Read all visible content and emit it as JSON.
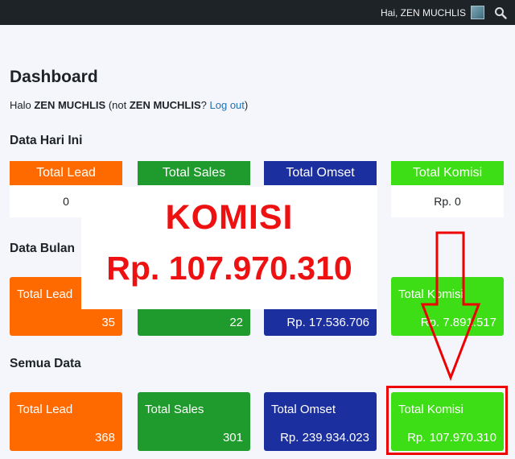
{
  "topbar": {
    "greeting": "Hai, ZEN MUCHLIS"
  },
  "page": {
    "title": "Dashboard",
    "hello_prefix": "Halo ",
    "user_name": "ZEN MUCHLIS",
    "not_prefix": " (not ",
    "user_name_again": "ZEN MUCHLIS",
    "question": "? ",
    "logout": "Log out",
    "close_paren": ")"
  },
  "sections": {
    "today": "Data Hari Ini",
    "month": "Data Bulan",
    "all": "Semua Data"
  },
  "today": [
    {
      "label": "Total Lead",
      "value": "0"
    },
    {
      "label": "Total Sales",
      "value": ""
    },
    {
      "label": "Total Omset",
      "value": ""
    },
    {
      "label": "Total Komisi",
      "value": "Rp. 0"
    }
  ],
  "month": [
    {
      "label": "Total Lead",
      "value": "35"
    },
    {
      "label": "",
      "value": "22"
    },
    {
      "label": "",
      "value": "Rp. 17.536.706"
    },
    {
      "label": "Total Komisi",
      "value": "Rp. 7.891.517"
    }
  ],
  "all": [
    {
      "label": "Total Lead",
      "value": "368"
    },
    {
      "label": "Total Sales",
      "value": "301"
    },
    {
      "label": "Total Omset",
      "value": "Rp. 239.934.023"
    },
    {
      "label": "Total Komisi",
      "value": "Rp. 107.970.310"
    }
  ],
  "overlay": {
    "title": "KOMISI",
    "amount": "Rp. 107.970.310"
  },
  "colors": {
    "orange": "#ff6a00",
    "green": "#1f9a2d",
    "blue": "#1b2f9f",
    "lime": "#3ede16",
    "annotation_red": "#ee0000"
  }
}
